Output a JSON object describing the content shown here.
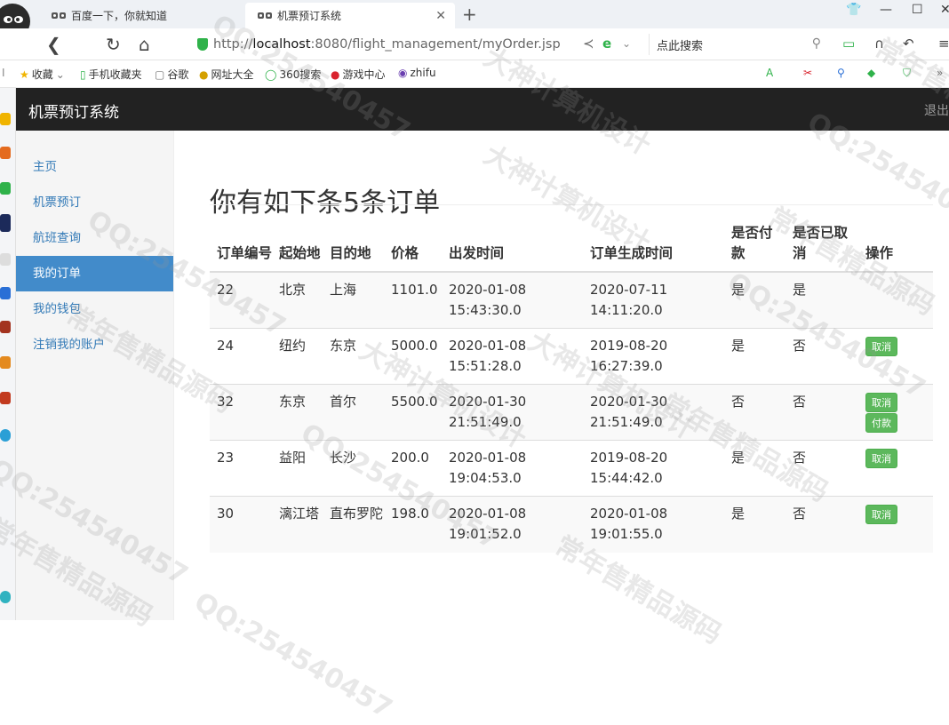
{
  "browser": {
    "tabs": [
      {
        "title": "百度一下，你就知道",
        "active": false
      },
      {
        "title": "机票预订系统",
        "active": true
      }
    ],
    "url_prefix": "http://",
    "url_host": "localhost",
    "url_path": ":8080/flight_management/myOrder.jsp",
    "search_placeholder": "点此搜索",
    "bookmarks": [
      {
        "label": "收藏",
        "icon": "star-icon"
      },
      {
        "label": "手机收藏夹",
        "icon": "phone-icon"
      },
      {
        "label": "谷歌",
        "icon": "page-icon"
      },
      {
        "label": "网址大全",
        "icon": "globe-icon"
      },
      {
        "label": "360搜索",
        "icon": "search-360-icon"
      },
      {
        "label": "游戏中心",
        "icon": "game-icon"
      },
      {
        "label": "zhifu",
        "icon": "zhifu-icon"
      }
    ]
  },
  "navbar": {
    "brand": "机票预订系统",
    "logout": "退出"
  },
  "sidebar": {
    "items": [
      {
        "label": "主页",
        "active": false
      },
      {
        "label": "机票预订",
        "active": false
      },
      {
        "label": "航班查询",
        "active": false
      },
      {
        "label": "我的订单",
        "active": true
      },
      {
        "label": "我的钱包",
        "active": false
      },
      {
        "label": "注销我的账户",
        "active": false
      }
    ]
  },
  "main": {
    "title": "你有如下条5条订单",
    "table": {
      "headers": [
        "订单编号",
        "起始地",
        "目的地",
        "价格",
        "出发时间",
        "订单生成时间",
        "是否付款",
        "是否已取消",
        "操作"
      ],
      "rows": [
        {
          "id": "22",
          "from": "北京",
          "to": "上海",
          "price": "1101.0",
          "depart": "2020-01-08 15:43:30.0",
          "created": "2020-07-11 14:11:20.0",
          "paid": "是",
          "cancelled": "是",
          "actions": []
        },
        {
          "id": "24",
          "from": "纽约",
          "to": "东京",
          "price": "5000.0",
          "depart": "2020-01-08 15:51:28.0",
          "created": "2019-08-20 16:27:39.0",
          "paid": "是",
          "cancelled": "否",
          "actions": [
            "取消"
          ]
        },
        {
          "id": "32",
          "from": "东京",
          "to": "首尔",
          "price": "5500.0",
          "depart": "2020-01-30 21:51:49.0",
          "created": "2020-01-30 21:51:49.0",
          "paid": "否",
          "cancelled": "否",
          "actions": [
            "取消",
            "付款"
          ]
        },
        {
          "id": "23",
          "from": "益阳",
          "to": "长沙",
          "price": "200.0",
          "depart": "2020-01-08 19:04:53.0",
          "created": "2019-08-20 15:44:42.0",
          "paid": "是",
          "cancelled": "否",
          "actions": [
            "取消"
          ]
        },
        {
          "id": "30",
          "from": "漓江塔",
          "to": "直布罗陀",
          "price": "198.0",
          "depart": "2020-01-08 19:01:52.0",
          "created": "2020-01-08 19:01:55.0",
          "paid": "是",
          "cancelled": "否",
          "actions": [
            "取消"
          ]
        }
      ]
    }
  },
  "watermarks": [
    "QQ:254540457",
    "常年售精品源码",
    "大神计算机设计"
  ],
  "colors": {
    "navbar": "#222222",
    "active_nav": "#428bca",
    "link": "#337ab7",
    "button_success": "#5cb85c"
  }
}
